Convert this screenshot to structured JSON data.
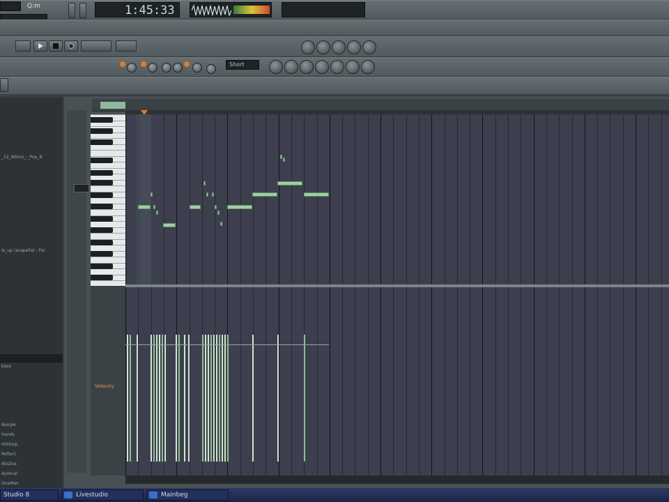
{
  "toolbar": {
    "song_time": "1:45:33",
    "hint_text": "Q:m",
    "counter_text": "0",
    "preset_box": "Short"
  },
  "browser": {
    "items": [
      "_12_Wiimo_-_Pop_B",
      "le_up (acapella) - Fer",
      "bass",
      "Boogie",
      "Hands",
      "Hotloop",
      "Reflect",
      "AtoZoe",
      "AyVocal",
      "OneMan"
    ]
  },
  "piano_roll": {
    "velocity_label": "Velocity"
  },
  "taskbar": {
    "items": [
      "Studio 8",
      "Livestudio",
      "Mainbeg"
    ]
  },
  "colors": {
    "note": "#9fd0a2",
    "grid": "#3d3f4e",
    "accent": "#e07a2a"
  }
}
